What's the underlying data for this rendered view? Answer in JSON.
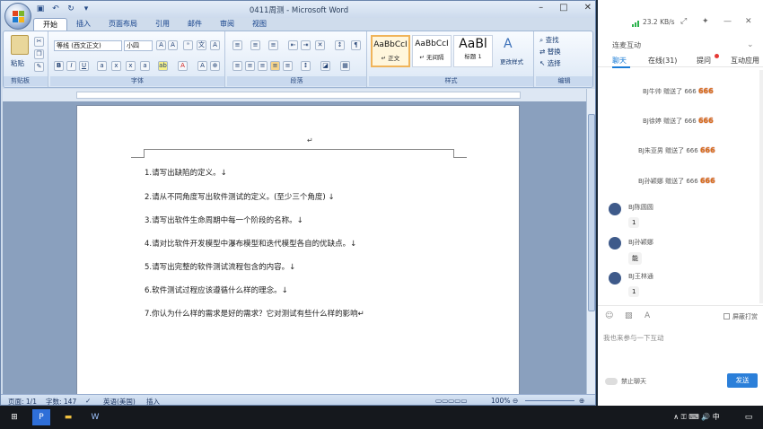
{
  "word": {
    "title": "0411周测 - Microsoft Word",
    "tabs": [
      "开始",
      "插入",
      "页面布局",
      "引用",
      "邮件",
      "审阅",
      "视图"
    ],
    "clipboard": {
      "paste": "粘贴",
      "label": "剪贴板"
    },
    "font": {
      "name": "等线 (西文正文)",
      "size": "小四",
      "label": "字体"
    },
    "paragraph_label": "段落",
    "styles": {
      "items": [
        {
          "sample": "AaBbCcI",
          "name": "↵ 正文"
        },
        {
          "sample": "AaBbCcI",
          "name": "↵ 无间隔"
        },
        {
          "sample": "AaBl",
          "name": "标题 1"
        }
      ],
      "change": "更改样式",
      "label": "样式"
    },
    "editing": {
      "find": "查找",
      "replace": "替换",
      "select": "选择",
      "label": "编辑"
    },
    "doc": {
      "header_mark": "↵",
      "questions": [
        "1.请写出缺陷的定义。↓",
        "2.请从不同角度写出软件测试的定义。(至少三个角度) ↓",
        "3.请写出软件生命周期中每一个阶段的名称。↓",
        "4.请对比软件开发模型中瀑布模型和迭代模型各自的优缺点。↓",
        "5.请写出完整的软件测试流程包含的内容。↓",
        "6.软件测试过程应该遵循什么样的理念。↓",
        "7.你认为什么样的需求是好的需求？它对测试有些什么样的影响↵"
      ]
    },
    "status": {
      "page": "页面: 1/1",
      "words": "字数: 147",
      "lang": "英语(美国)",
      "mode": "插入",
      "zoom": "100%"
    }
  },
  "chat": {
    "speed": "23.2 KB/s",
    "title": "连麦互动",
    "tabs": [
      "聊天",
      "在线(31)",
      "提问",
      "互动应用"
    ],
    "gifts": [
      {
        "user": "BJ牛帅",
        "text": "赠送了 666",
        "badge": "666"
      },
      {
        "user": "BJ徐婷",
        "text": "赠送了 666",
        "badge": "666"
      },
      {
        "user": "BJ朱亚男",
        "text": "赠送了 666",
        "badge": "666"
      },
      {
        "user": "BJ孙颖娜",
        "text": "赠送了 666",
        "badge": "666"
      }
    ],
    "messages": [
      {
        "user": "BJ陈圆圆",
        "text": "1"
      },
      {
        "user": "BJ孙颖娜",
        "text": "能"
      },
      {
        "user": "BJ王林通",
        "text": "1"
      }
    ],
    "screen_dialog": "屏蔽打赏",
    "placeholder": "我也来参与一下互动",
    "ban": "禁止聊天",
    "send": "发送"
  },
  "taskbar": {
    "ime": "中",
    "tray": "∧ ⚿ ⌨ 🔊 中"
  }
}
